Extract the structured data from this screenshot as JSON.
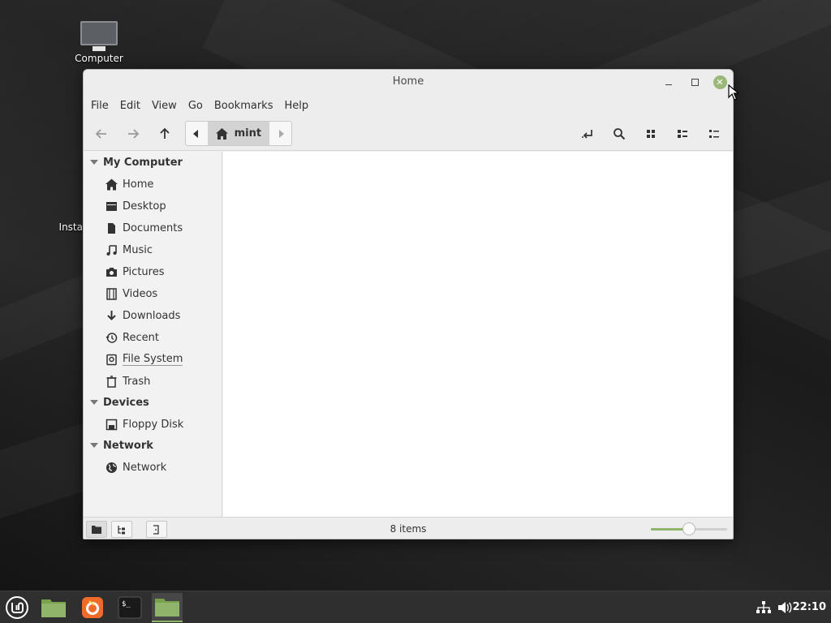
{
  "desktop": {
    "icons": [
      {
        "label": "Computer"
      },
      {
        "label": "Insta"
      }
    ]
  },
  "window": {
    "title": "Home",
    "menu": [
      "File",
      "Edit",
      "View",
      "Go",
      "Bookmarks",
      "Help"
    ],
    "path": {
      "current": "mint"
    },
    "sidebar": {
      "sections": [
        {
          "title": "My Computer",
          "items": [
            "Home",
            "Desktop",
            "Documents",
            "Music",
            "Pictures",
            "Videos",
            "Downloads",
            "Recent",
            "File System",
            "Trash"
          ]
        },
        {
          "title": "Devices",
          "items": [
            "Floppy Disk"
          ]
        },
        {
          "title": "Network",
          "items": [
            "Network"
          ]
        }
      ]
    },
    "status": {
      "items": "8 items",
      "zoom_level": 0.5
    }
  },
  "taskbar": {
    "clock": "22:10"
  },
  "colors": {
    "accent": "#8fb46a",
    "close": "#9ab87a"
  }
}
